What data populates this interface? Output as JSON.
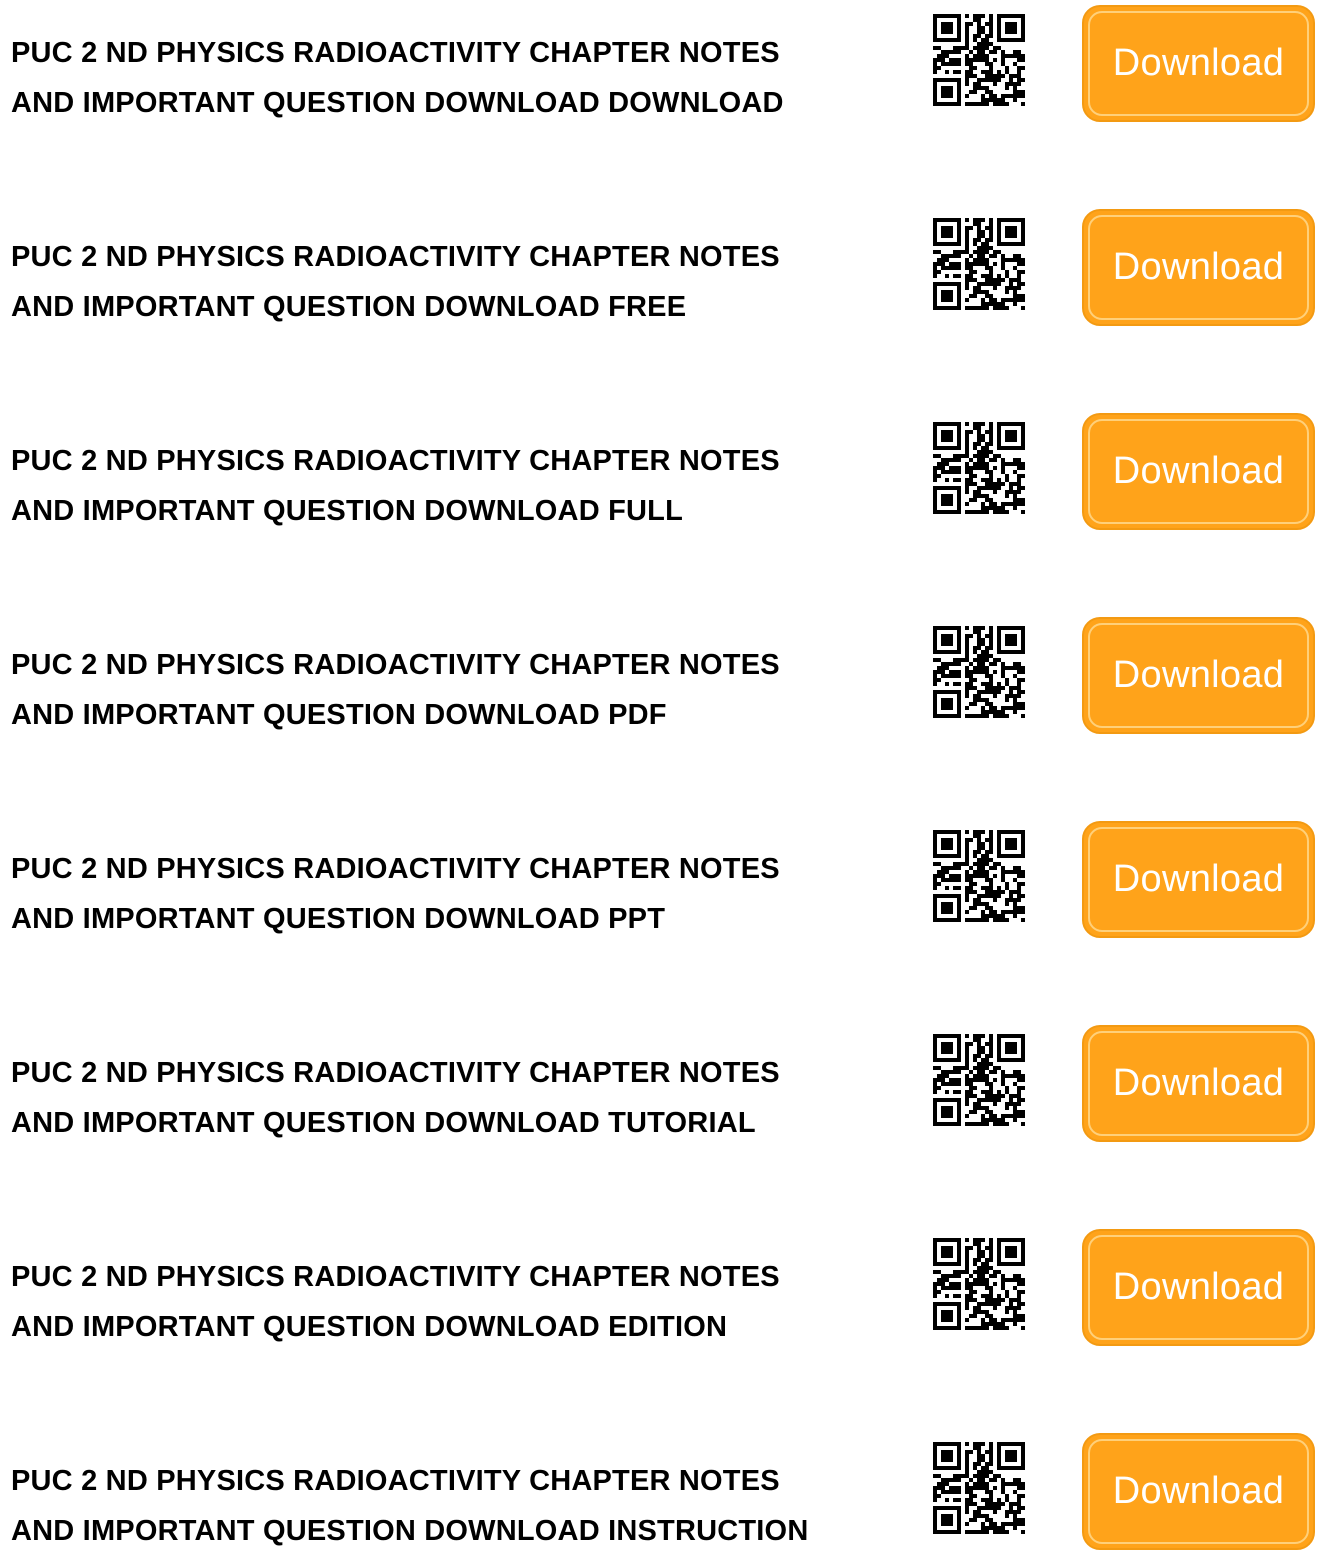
{
  "colors": {
    "button_fill": "#ffa31a",
    "button_text": "#ffffff",
    "title_text": "#000000"
  },
  "items": [
    {
      "title_line1": "PUC 2 ND PHYSICS RADIOACTIVITY CHAPTER NOTES",
      "title_line2": "AND IMPORTANT QUESTION DOWNLOAD DOWNLOAD",
      "qr_icon": "qr-code-icon",
      "button_label": "Download"
    },
    {
      "title_line1": "PUC 2 ND PHYSICS RADIOACTIVITY CHAPTER NOTES",
      "title_line2": "AND IMPORTANT QUESTION DOWNLOAD FREE",
      "qr_icon": "qr-code-icon",
      "button_label": "Download"
    },
    {
      "title_line1": "PUC 2 ND PHYSICS RADIOACTIVITY CHAPTER NOTES",
      "title_line2": "AND IMPORTANT QUESTION DOWNLOAD FULL",
      "qr_icon": "qr-code-icon",
      "button_label": "Download"
    },
    {
      "title_line1": "PUC 2 ND PHYSICS RADIOACTIVITY CHAPTER NOTES",
      "title_line2": "AND IMPORTANT QUESTION DOWNLOAD PDF",
      "qr_icon": "qr-code-icon",
      "button_label": "Download"
    },
    {
      "title_line1": "PUC 2 ND PHYSICS RADIOACTIVITY CHAPTER NOTES",
      "title_line2": "AND IMPORTANT QUESTION DOWNLOAD PPT",
      "qr_icon": "qr-code-icon",
      "button_label": "Download"
    },
    {
      "title_line1": "PUC 2 ND PHYSICS RADIOACTIVITY CHAPTER NOTES",
      "title_line2": "AND IMPORTANT QUESTION DOWNLOAD TUTORIAL",
      "qr_icon": "qr-code-icon",
      "button_label": "Download"
    },
    {
      "title_line1": "PUC 2 ND PHYSICS RADIOACTIVITY CHAPTER NOTES",
      "title_line2": "AND IMPORTANT QUESTION DOWNLOAD EDITION",
      "qr_icon": "qr-code-icon",
      "button_label": "Download"
    },
    {
      "title_line1": "PUC 2 ND PHYSICS RADIOACTIVITY CHAPTER NOTES",
      "title_line2": "AND IMPORTANT QUESTION DOWNLOAD INSTRUCTION",
      "qr_icon": "qr-code-icon",
      "button_label": "Download"
    }
  ]
}
